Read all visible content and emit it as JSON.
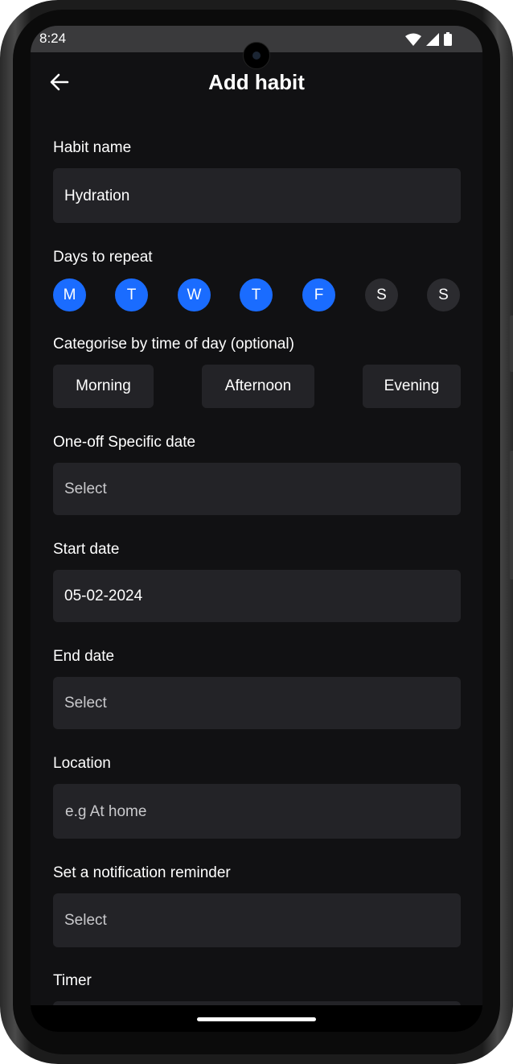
{
  "status": {
    "time": "8:24"
  },
  "header": {
    "title": "Add habit"
  },
  "habit_name": {
    "label": "Habit name",
    "value": "Hydration"
  },
  "days": {
    "label": "Days to repeat",
    "items": [
      {
        "letter": "M",
        "selected": true
      },
      {
        "letter": "T",
        "selected": true
      },
      {
        "letter": "W",
        "selected": true
      },
      {
        "letter": "T",
        "selected": true
      },
      {
        "letter": "F",
        "selected": true
      },
      {
        "letter": "S",
        "selected": false
      },
      {
        "letter": "S",
        "selected": false
      }
    ]
  },
  "time_of_day": {
    "label": "Categorise by time of day (optional)",
    "options": [
      "Morning",
      "Afternoon",
      "Evening"
    ]
  },
  "one_off": {
    "label": "One-off Specific date",
    "placeholder": "Select"
  },
  "start_date": {
    "label": "Start date",
    "value": "05-02-2024"
  },
  "end_date": {
    "label": "End date",
    "placeholder": "Select"
  },
  "location": {
    "label": "Location",
    "placeholder": "e.g At home"
  },
  "reminder": {
    "label": "Set a notification reminder",
    "placeholder": "Select"
  },
  "timer": {
    "label": "Timer"
  },
  "colors": {
    "accent": "#1a6cff",
    "background": "#111113",
    "field": "#232327"
  },
  "icons": {
    "back": "arrow-left-icon",
    "wifi": "wifi-icon",
    "signal": "signal-icon",
    "battery": "battery-icon"
  }
}
